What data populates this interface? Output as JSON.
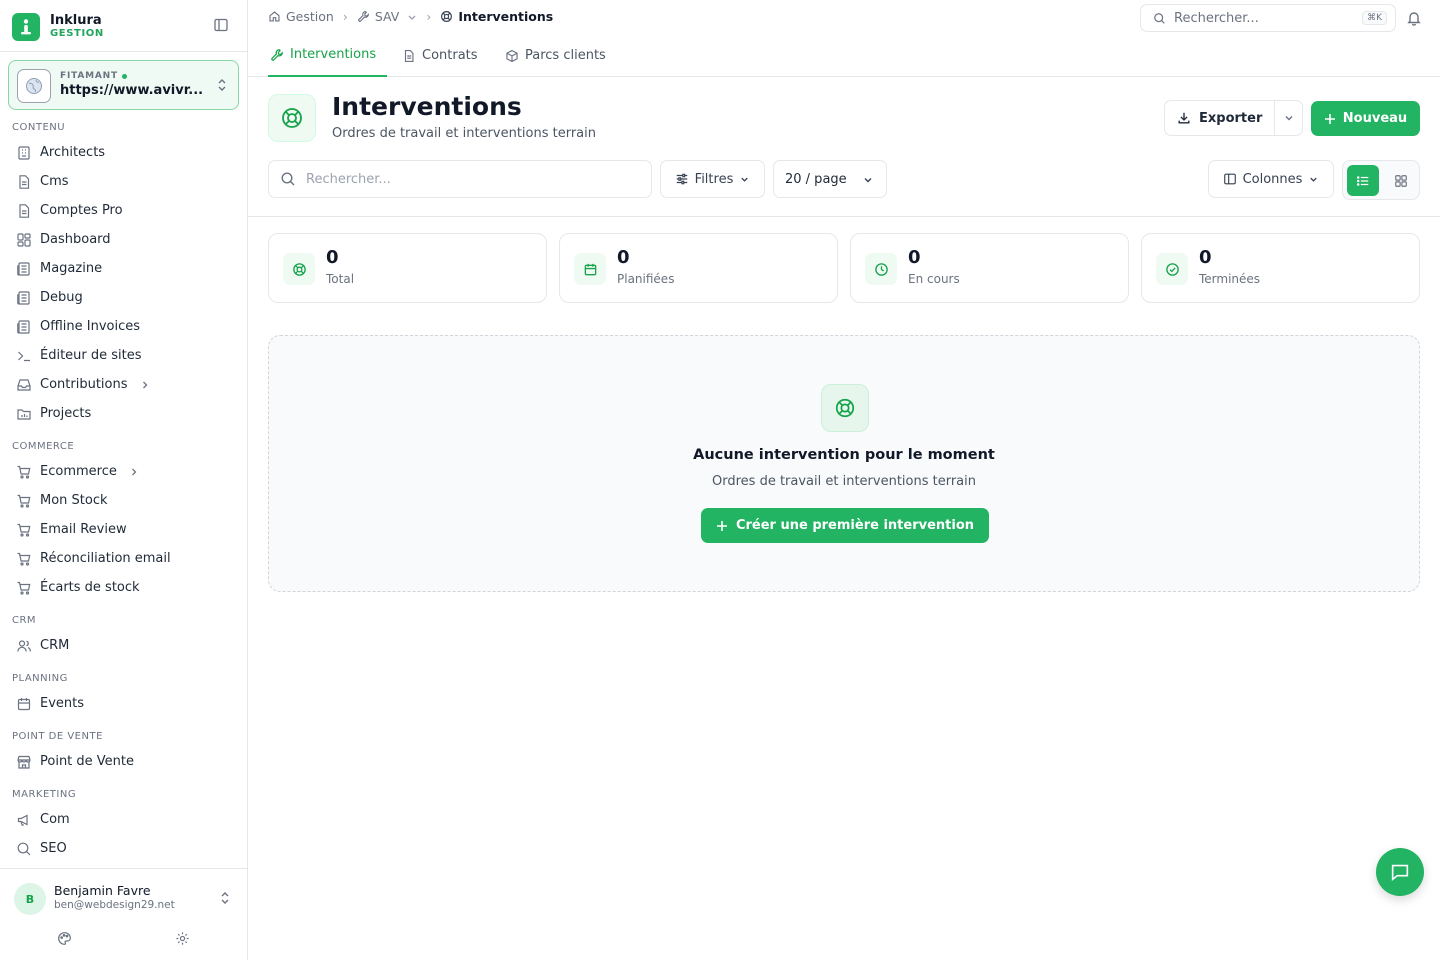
{
  "brand": {
    "name": "Inklura",
    "sub": "GESTION"
  },
  "site": {
    "label": "FITAMANT",
    "url": "https://www.avivr..."
  },
  "sidebar": {
    "groups": [
      {
        "label": "CONTENU",
        "items": [
          {
            "label": "Architects",
            "icon": "building-icon"
          },
          {
            "label": "Cms",
            "icon": "file-icon"
          },
          {
            "label": "Comptes Pro",
            "icon": "file-icon"
          },
          {
            "label": "Dashboard",
            "icon": "dashboard-icon"
          },
          {
            "label": "Magazine",
            "icon": "newspaper-icon"
          },
          {
            "label": "Debug",
            "icon": "newspaper-icon"
          },
          {
            "label": "Offline Invoices",
            "icon": "newspaper-icon"
          },
          {
            "label": "Éditeur de sites",
            "icon": "terminal-icon"
          },
          {
            "label": "Contributions",
            "icon": "inbox-icon",
            "chevron": true
          },
          {
            "label": "Projects",
            "icon": "folder-chart-icon"
          }
        ]
      },
      {
        "label": "COMMERCE",
        "items": [
          {
            "label": "Ecommerce",
            "icon": "cart-icon",
            "chevron": true
          },
          {
            "label": "Mon Stock",
            "icon": "cart-icon"
          },
          {
            "label": "Email Review",
            "icon": "cart-icon"
          },
          {
            "label": "Réconciliation email",
            "icon": "cart-icon"
          },
          {
            "label": "Écarts de stock",
            "icon": "cart-icon"
          }
        ]
      },
      {
        "label": "CRM",
        "items": [
          {
            "label": "CRM",
            "icon": "users-icon"
          }
        ]
      },
      {
        "label": "PLANNING",
        "items": [
          {
            "label": "Events",
            "icon": "calendar-icon"
          }
        ]
      },
      {
        "label": "POINT DE VENTE",
        "items": [
          {
            "label": "Point de Vente",
            "icon": "store-icon"
          }
        ]
      },
      {
        "label": "MARKETING",
        "items": [
          {
            "label": "Com",
            "icon": "megaphone-icon"
          },
          {
            "label": "SEO",
            "icon": "search-icon"
          }
        ]
      }
    ]
  },
  "user": {
    "initial": "B",
    "name": "Benjamin Favre",
    "email": "ben@webdesign29.net"
  },
  "breadcrumb": {
    "home": "Gestion",
    "section": "SAV",
    "current": "Interventions"
  },
  "topsearch": {
    "placeholder": "Rechercher...",
    "shortcut": "⌘K"
  },
  "tabs": [
    {
      "label": "Interventions",
      "active": true
    },
    {
      "label": "Contrats",
      "active": false
    },
    {
      "label": "Parcs clients",
      "active": false
    }
  ],
  "page": {
    "title": "Interventions",
    "subtitle": "Ordres de travail et interventions terrain"
  },
  "actions": {
    "export": "Exporter",
    "new": "Nouveau"
  },
  "toolbar": {
    "search_placeholder": "Rechercher...",
    "filters": "Filtres",
    "per_page": "20 / page",
    "columns": "Colonnes"
  },
  "stats": [
    {
      "value": "0",
      "label": "Total",
      "icon": "lifebuoy-icon"
    },
    {
      "value": "0",
      "label": "Planifiées",
      "icon": "calendar-icon"
    },
    {
      "value": "0",
      "label": "En cours",
      "icon": "clock-icon"
    },
    {
      "value": "0",
      "label": "Terminées",
      "icon": "check-circle-icon"
    }
  ],
  "empty": {
    "title": "Aucune intervention pour le moment",
    "subtitle": "Ordres de travail et interventions terrain",
    "button": "Créer une première intervention"
  },
  "colors": {
    "accent": "#22b363",
    "accent_text": "#16a34a",
    "border": "#e5e7eb"
  }
}
